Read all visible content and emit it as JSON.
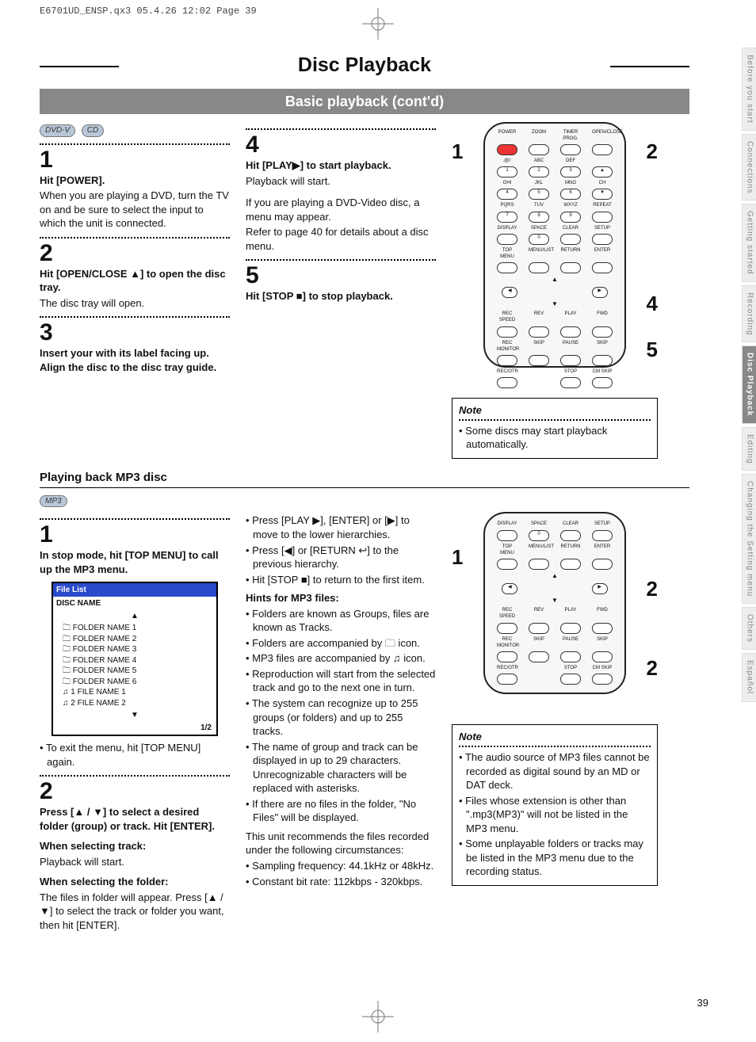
{
  "meta": {
    "slug": "E6701UD_ENSP.qx3  05.4.26 12:02  Page 39"
  },
  "page_number": "39",
  "title": "Disc Playback",
  "section": "Basic playback (cont'd)",
  "badges": {
    "dvd": "DVD-V",
    "cd": "CD",
    "mp3": "MP3"
  },
  "tabs": [
    "Before you start",
    "Connections",
    "Getting started",
    "Recording",
    "Disc Playback",
    "Editing",
    "Changing the Setting menu",
    "Others",
    "Español"
  ],
  "tab_active": "Disc Playback",
  "col1": {
    "s1": {
      "n": "1",
      "h": "Hit [POWER].",
      "p": "When you are playing a DVD, turn the TV on and be sure to select the input to which the unit is connected."
    },
    "s2": {
      "n": "2",
      "h": "Hit [OPEN/CLOSE ▲] to open the disc tray.",
      "p": "The disc tray will open."
    },
    "s3": {
      "n": "3",
      "h": "Insert your with its label facing up. Align the disc to the disc tray guide."
    }
  },
  "col2": {
    "s4": {
      "n": "4",
      "h": "Hit [PLAY▶] to start playback.",
      "p1": "Playback will start.",
      "p2": "If you are playing a DVD-Video disc, a menu may appear.",
      "p3": "Refer to page 40 for details about a disc menu."
    },
    "s5": {
      "n": "5",
      "h": "Hit [STOP ■] to stop playback."
    }
  },
  "note1": {
    "label": "Note",
    "items": [
      "Some discs may start playback automatically."
    ]
  },
  "subhead": "Playing back MP3 disc",
  "mp3_col1": {
    "s1": {
      "n": "1",
      "h": "In stop mode, hit [TOP MENU] to call up the MP3 menu."
    },
    "exit": "To exit the menu, hit [TOP MENU] again.",
    "s2": {
      "n": "2",
      "h": "Press [▲ / ▼] to select a desired folder (group) or track. Hit [ENTER].",
      "track_h": "When selecting track:",
      "track_p": "Playback will start.",
      "folder_h": "When selecting the folder:",
      "folder_p": "The files in folder will appear. Press [▲ / ▼] to select the track or folder you want, then hit [ENTER]."
    }
  },
  "filelist": {
    "title": "File List",
    "disc": "DISC NAME",
    "rows": [
      "FOLDER NAME 1",
      "FOLDER NAME 2",
      "FOLDER NAME 3",
      "FOLDER NAME 4",
      "FOLDER NAME 5",
      "FOLDER NAME 6",
      "1 FILE NAME 1",
      "2 FILE NAME 2"
    ],
    "pager": "1/2"
  },
  "mp3_col2": {
    "bul1": [
      "Press [PLAY ▶], [ENTER] or [▶] to move to the lower hierarchies.",
      "Press [◀] or [RETURN ↩] to the previous hierarchy.",
      "Hit [STOP ■] to return to the first item."
    ],
    "hints_h": "Hints for MP3 files:",
    "bul2": [
      "Folders are known as Groups, files are known as Tracks.",
      "Folders are accompanied by 🗀 icon.",
      "MP3 files are accompanied by ♫ icon.",
      "Reproduction will start from the selected track and go to the next one in turn.",
      "The system can recognize up to 255 groups (or folders) and up to 255 tracks.",
      "The name of group and track can be displayed in up to 29 characters. Unrecognizable characters will be replaced with asterisks.",
      "If there are no files in the folder, \"No Files\" will be displayed."
    ],
    "rec": "This unit recommends the files recorded under the following circumstances:",
    "bul3": [
      "Sampling frequency: 44.1kHz or 48kHz.",
      "Constant bit rate: 112kbps - 320kbps."
    ]
  },
  "note2": {
    "label": "Note",
    "items": [
      "The audio source of MP3 files cannot be recorded as digital sound by an MD or DAT deck.",
      "Files whose extension is other than \".mp3(MP3)\" will not be listed in the MP3 menu.",
      "Some unplayable folders or tracks may be listed in the MP3 menu due to the recording status."
    ]
  },
  "remote": {
    "row1": [
      "POWER",
      "",
      "ZOOM",
      "TIMER PROG.",
      "OPEN/CLOSE"
    ],
    "row2": [
      ".@/:",
      "ABC",
      "DEF",
      ""
    ],
    "row2n": [
      "1",
      "2",
      "3",
      "▲"
    ],
    "row3": [
      "GHI",
      "JKL",
      "MNO",
      "CH"
    ],
    "row3n": [
      "4",
      "5",
      "6",
      "▼"
    ],
    "row4": [
      "PQRS",
      "TUV",
      "WXYZ",
      "REPEAT"
    ],
    "row4n": [
      "7",
      "8",
      "9",
      ""
    ],
    "row5": [
      "DISPLAY",
      "SPACE",
      "CLEAR",
      "SETUP"
    ],
    "row5n": [
      "",
      "0",
      "",
      ""
    ],
    "row6": [
      "TOP MENU",
      "MENU/LIST",
      "RETURN",
      "ENTER"
    ],
    "nav": [
      "▲",
      "◀",
      "▶",
      "▼"
    ],
    "row7": [
      "REC SPEED",
      "REV",
      "PLAY",
      "FWD"
    ],
    "row8": [
      "REC MONITOR",
      "SKIP",
      "PAUSE",
      "SKIP"
    ],
    "row9": [
      "REC/OTR",
      "",
      "STOP",
      "CM SKIP"
    ]
  },
  "callouts1": {
    "c1": "1",
    "c2": "2",
    "c4": "4",
    "c5": "5"
  },
  "callouts2": {
    "c1": "1",
    "c2a": "2",
    "c2b": "2"
  }
}
